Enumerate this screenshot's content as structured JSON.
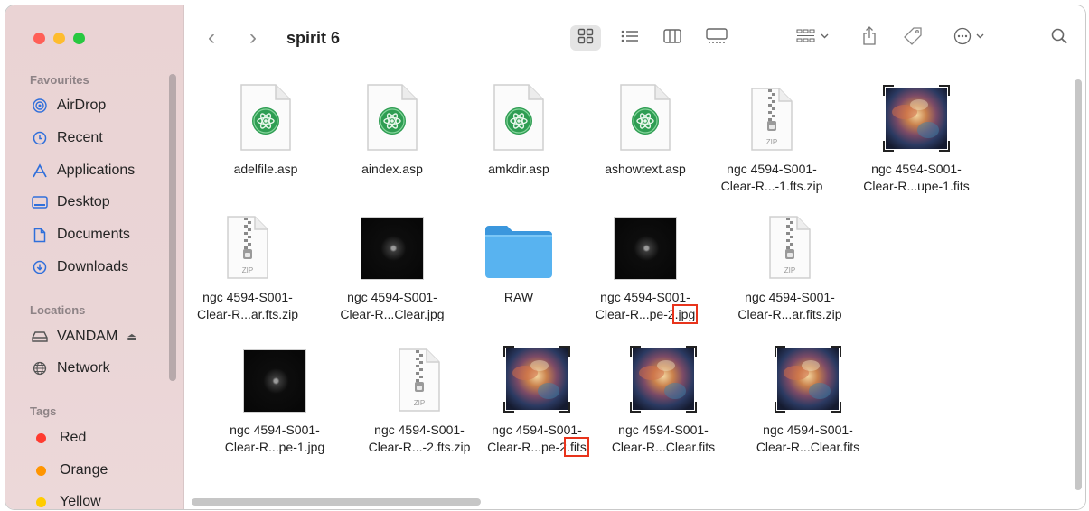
{
  "window": {
    "title": "spirit 6"
  },
  "sidebar": {
    "favourites_heading": "Favourites",
    "favourites": [
      {
        "label": "AirDrop",
        "icon": "airdrop-icon"
      },
      {
        "label": "Recent",
        "icon": "clock-icon"
      },
      {
        "label": "Applications",
        "icon": "applications-icon"
      },
      {
        "label": "Desktop",
        "icon": "desktop-icon"
      },
      {
        "label": "Documents",
        "icon": "document-icon"
      },
      {
        "label": "Downloads",
        "icon": "download-icon"
      }
    ],
    "locations_heading": "Locations",
    "locations": [
      {
        "label": "VANDAM",
        "icon": "drive-icon",
        "eject": "⏏"
      },
      {
        "label": "Network",
        "icon": "network-icon"
      }
    ],
    "tags_heading": "Tags",
    "tags": [
      {
        "label": "Red",
        "color": "#ff3b30"
      },
      {
        "label": "Orange",
        "color": "#ff9500"
      },
      {
        "label": "Yellow",
        "color": "#ffcc00"
      }
    ]
  },
  "toolbar": {
    "back": "‹",
    "forward": "›",
    "view_icons": [
      "icon-view-icon",
      "list-view-icon",
      "column-view-icon",
      "gallery-view-icon"
    ],
    "group_icon": "group-icon",
    "share_icon": "share-icon",
    "tag_icon": "tag-icon",
    "more_icon": "more-icon",
    "search_icon": "search-icon"
  },
  "files": [
    {
      "line1": "adelfile.asp",
      "line2": "",
      "kind": "asp"
    },
    {
      "line1": "aindex.asp",
      "line2": "",
      "kind": "asp"
    },
    {
      "line1": "amkdir.asp",
      "line2": "",
      "kind": "asp"
    },
    {
      "line1": "ashowtext.asp",
      "line2": "",
      "kind": "asp"
    },
    {
      "line1": "ngc 4594-S001-",
      "line2": "Clear-R...-1.fts.zip",
      "kind": "zip"
    },
    {
      "line1": "ngc 4594-S001-",
      "line2": "Clear-R...upe-1.fits",
      "kind": "fits"
    },
    {
      "line1": "ngc 4594-S001-",
      "line2": "Clear-R...ar.fts.zip",
      "kind": "zip"
    },
    {
      "line1": "ngc 4594-S001-",
      "line2": "Clear-R...Clear.jpg",
      "kind": "jpg"
    },
    {
      "line1": "RAW",
      "line2": "",
      "kind": "folder"
    },
    {
      "line1": "ngc 4594-S001-",
      "line2": "Clear-R...pe-2",
      "ext": ".jpg",
      "kind": "jpg",
      "highlight": true
    },
    {
      "line1": "ngc 4594-S001-",
      "line2": "Clear-R...ar.fits.zip",
      "kind": "zip"
    },
    {
      "line1": "ngc 4594-S001-",
      "line2": "Clear-R...pe-1.jpg",
      "kind": "jpg"
    },
    {
      "line1": "ngc 4594-S001-",
      "line2": "Clear-R...-2.fts.zip",
      "kind": "zip"
    },
    {
      "line1": "ngc 4594-S001-",
      "line2": "Clear-R...pe-2",
      "ext": ".fits",
      "kind": "fits",
      "highlight": true
    },
    {
      "line1": "ngc 4594-S001-",
      "line2": "Clear-R...Clear.fits",
      "kind": "fits"
    },
    {
      "line1": "ngc 4594-S001-",
      "line2": "Clear-R...Clear.fits",
      "kind": "fits"
    }
  ],
  "zip_label": "ZIP",
  "colors": {
    "accent": "#2f6fdb",
    "highlight": "#e8341c",
    "folder": "#4aa8ea"
  }
}
